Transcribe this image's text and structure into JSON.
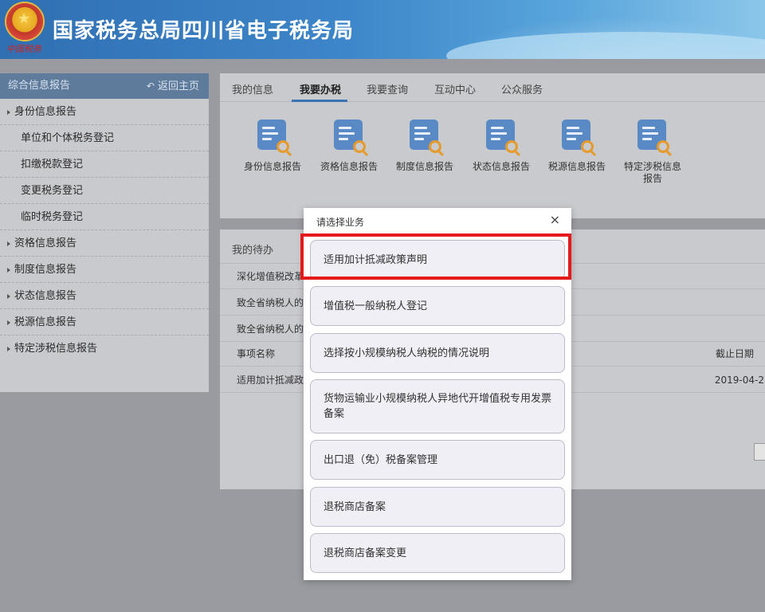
{
  "header": {
    "title": "国家税务总局四川省电子税务局",
    "signature": "中国税务"
  },
  "sidebar": {
    "title": "综合信息报告",
    "back_label": "返回主页",
    "items": [
      {
        "label": "身份信息报告",
        "level": "top"
      },
      {
        "label": "单位和个体税务登记",
        "level": "sub"
      },
      {
        "label": "扣缴税款登记",
        "level": "sub"
      },
      {
        "label": "变更税务登记",
        "level": "sub"
      },
      {
        "label": "临时税务登记",
        "level": "sub"
      },
      {
        "label": "资格信息报告",
        "level": "top"
      },
      {
        "label": "制度信息报告",
        "level": "top"
      },
      {
        "label": "状态信息报告",
        "level": "top"
      },
      {
        "label": "税源信息报告",
        "level": "top"
      },
      {
        "label": "特定涉税信息报告",
        "level": "top"
      }
    ]
  },
  "main": {
    "tabs": [
      {
        "label": "我的信息"
      },
      {
        "label": "我要办税",
        "active": true
      },
      {
        "label": "我要查询"
      },
      {
        "label": "互动中心"
      },
      {
        "label": "公众服务"
      }
    ],
    "icons": [
      {
        "label": "身份信息报告",
        "icon": "document-search-icon"
      },
      {
        "label": "资格信息报告",
        "icon": "document-search-icon"
      },
      {
        "label": "制度信息报告",
        "icon": "document-search-icon"
      },
      {
        "label": "状态信息报告",
        "icon": "document-search-icon"
      },
      {
        "label": "税源信息报告",
        "icon": "document-search-icon"
      },
      {
        "label": "特定涉税信息报告",
        "icon": "document-search-icon"
      }
    ],
    "todo_tab": "我的待办",
    "notices": [
      "深化增值税改革",
      "致全省纳税人的",
      "致全省纳税人的"
    ],
    "table": {
      "headers": {
        "item": "事项名称",
        "deadline": "截止日期"
      },
      "rows": [
        {
          "item": "适用加计抵减政",
          "deadline": "2019-04-2"
        }
      ]
    }
  },
  "modal": {
    "title": "请选择业务",
    "close": "×",
    "options": [
      "适用加计抵减政策声明",
      "增值税一般纳税人登记",
      "选择按小规模纳税人纳税的情况说明",
      "货物运输业小规模纳税人异地代开增值税专用发票备案",
      "出口退（免）税备案管理",
      "退税商店备案",
      "退税商店备案变更"
    ]
  },
  "colors": {
    "accent": "#3b73b5",
    "highlight": "#e3191b",
    "icon_blue": "#5a8ac6",
    "icon_orange": "#e59a2b"
  }
}
